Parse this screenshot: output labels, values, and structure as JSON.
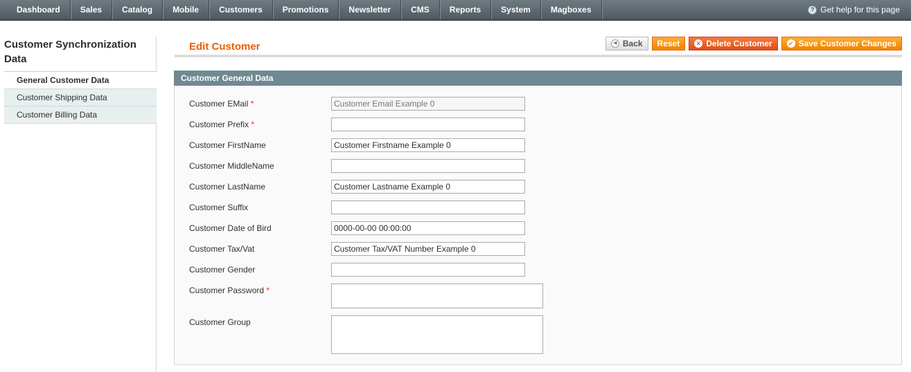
{
  "topnav": {
    "items": [
      {
        "label": "Dashboard"
      },
      {
        "label": "Sales"
      },
      {
        "label": "Catalog"
      },
      {
        "label": "Mobile"
      },
      {
        "label": "Customers"
      },
      {
        "label": "Promotions"
      },
      {
        "label": "Newsletter"
      },
      {
        "label": "CMS"
      },
      {
        "label": "Reports"
      },
      {
        "label": "System"
      },
      {
        "label": "Magboxes"
      }
    ],
    "help_label": "Get help for this page"
  },
  "sidebar": {
    "title": "Customer Synchronization Data",
    "tabs": [
      {
        "label": "General Customer Data"
      },
      {
        "label": "Customer Shipping Data"
      },
      {
        "label": "Customer Billing Data"
      }
    ]
  },
  "page": {
    "title": "Edit Customer",
    "buttons": {
      "back": "Back",
      "reset": "Reset",
      "delete": "Delete Customer",
      "save": "Save Customer Changes"
    }
  },
  "form": {
    "section_title": "Customer General Data",
    "required_mark": "*",
    "fields": {
      "email": {
        "label": "Customer EMail",
        "value": "Customer Email Example 0"
      },
      "prefix": {
        "label": "Customer Prefix",
        "value": ""
      },
      "firstname": {
        "label": "Customer FirstName",
        "value": "Customer Firstname Example 0"
      },
      "middlename": {
        "label": "Customer MiddleName",
        "value": ""
      },
      "lastname": {
        "label": "Customer LastName",
        "value": "Customer Lastname Example 0"
      },
      "suffix": {
        "label": "Customer Suffix",
        "value": ""
      },
      "dob": {
        "label": "Customer Date of Bird",
        "value": "0000-00-00 00:00:00"
      },
      "taxvat": {
        "label": "Customer Tax/Vat",
        "value": "Customer Tax/VAT Number Example 0"
      },
      "gender": {
        "label": "Customer Gender",
        "value": ""
      },
      "password": {
        "label": "Customer Password",
        "value": ""
      },
      "group": {
        "label": "Customer Group",
        "value": ""
      }
    }
  }
}
